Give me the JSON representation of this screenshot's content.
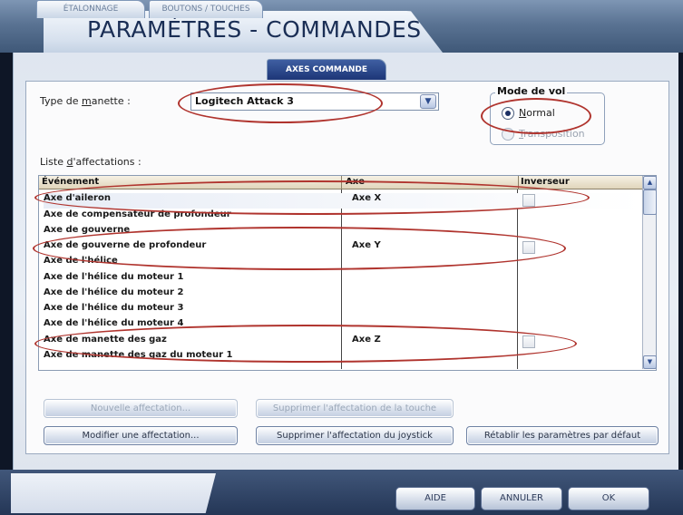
{
  "window": {
    "title": "PARAMÈTRES - COMMANDES"
  },
  "tabs": [
    {
      "label": "ÉTALONNAGE",
      "active": false
    },
    {
      "label": "BOUTONS / TOUCHES",
      "active": false
    },
    {
      "label": "AXES COMMANDE",
      "active": true
    }
  ],
  "controller": {
    "type_label_pre": "Type de ",
    "type_label_underline": "m",
    "type_label_post": "anette :",
    "selected": "Logitech Attack 3"
  },
  "flight_mode": {
    "legend": "Mode de vol",
    "options": [
      {
        "label_underline": "N",
        "label_rest": "ormal",
        "selected": true,
        "enabled": true
      },
      {
        "label_underline": "T",
        "label_rest": "ransposition",
        "selected": false,
        "enabled": false
      }
    ]
  },
  "assignments": {
    "label_pre": "Liste ",
    "label_underline": "d",
    "label_post": "'affectations :",
    "columns": [
      "Événement",
      "Axe",
      "Inverseur"
    ],
    "rows": [
      {
        "event": "Axe d'aileron",
        "axis": "Axe X",
        "invert": false,
        "has_checkbox": true
      },
      {
        "event": "Axe de compensateur de profondeur",
        "axis": "",
        "invert": false,
        "has_checkbox": false
      },
      {
        "event": "Axe de gouverne",
        "axis": "",
        "invert": false,
        "has_checkbox": false
      },
      {
        "event": "Axe de gouverne de profondeur",
        "axis": "Axe Y",
        "invert": false,
        "has_checkbox": true
      },
      {
        "event": "Axe de l'hélice",
        "axis": "",
        "invert": false,
        "has_checkbox": false
      },
      {
        "event": "Axe de l'hélice du moteur 1",
        "axis": "",
        "invert": false,
        "has_checkbox": false
      },
      {
        "event": "Axe de l'hélice du moteur 2",
        "axis": "",
        "invert": false,
        "has_checkbox": false
      },
      {
        "event": "Axe de l'hélice du moteur 3",
        "axis": "",
        "invert": false,
        "has_checkbox": false
      },
      {
        "event": "Axe de l'hélice du moteur 4",
        "axis": "",
        "invert": false,
        "has_checkbox": false
      },
      {
        "event": "Axe de manette des gaz",
        "axis": "Axe Z",
        "invert": false,
        "has_checkbox": true
      },
      {
        "event": "Axe de manette des gaz du moteur 1",
        "axis": "",
        "invert": false,
        "has_checkbox": false
      }
    ]
  },
  "buttons": {
    "new_assignment": "Nouvelle affectation...",
    "delete_key_assignment": "Supprimer l'affectation de la touche",
    "modify_assignment": "Modifier une affectation...",
    "delete_joystick_assignment": "Supprimer l'affectation du joystick",
    "reset_defaults": "Rétablir les paramètres par défaut",
    "help": "AIDE",
    "cancel": "ANNULER",
    "ok": "OK"
  },
  "colors": {
    "annotation": "#b0342e",
    "accent": "#1d3677",
    "title": "#1a2e55"
  }
}
